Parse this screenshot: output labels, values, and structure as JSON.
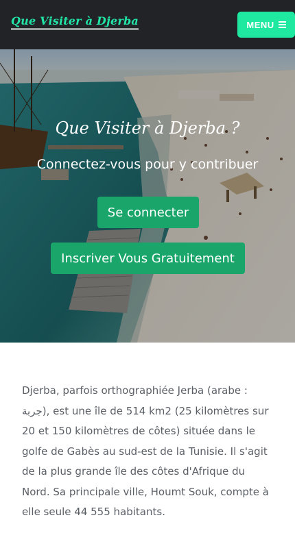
{
  "navbar": {
    "brand": "Que Visiter à Djerba",
    "menu_label": "MENU",
    "menu_icon": "hamburger-icon"
  },
  "hero": {
    "title": "Que Visiter à Djerba ?",
    "subtitle": "Connectez-vous pour y contribuer",
    "login_button": "Se connecter",
    "signup_button": "Inscriver Vous Gratuitement"
  },
  "content": {
    "paragraph": "Djerba, parfois orthographiée Jerba (arabe : جربة), est une île de 514 km2 (25 kilomètres sur 20 et 150 kilomètres de côtes) située dans le golfe de Gabès au sud-est de la Tunisie. Il s'agit de la plus grande île des côtes d'Afrique du Nord. Sa principale ville, Houmt Souk, compte à elle seule 44 555 habitants."
  },
  "colors": {
    "navbar_bg": "#222326",
    "brand_green": "#21e6a6",
    "menu_bg": "#1fe8a1",
    "button_green": "#1aa66a",
    "text_gray": "#5a5f66"
  }
}
